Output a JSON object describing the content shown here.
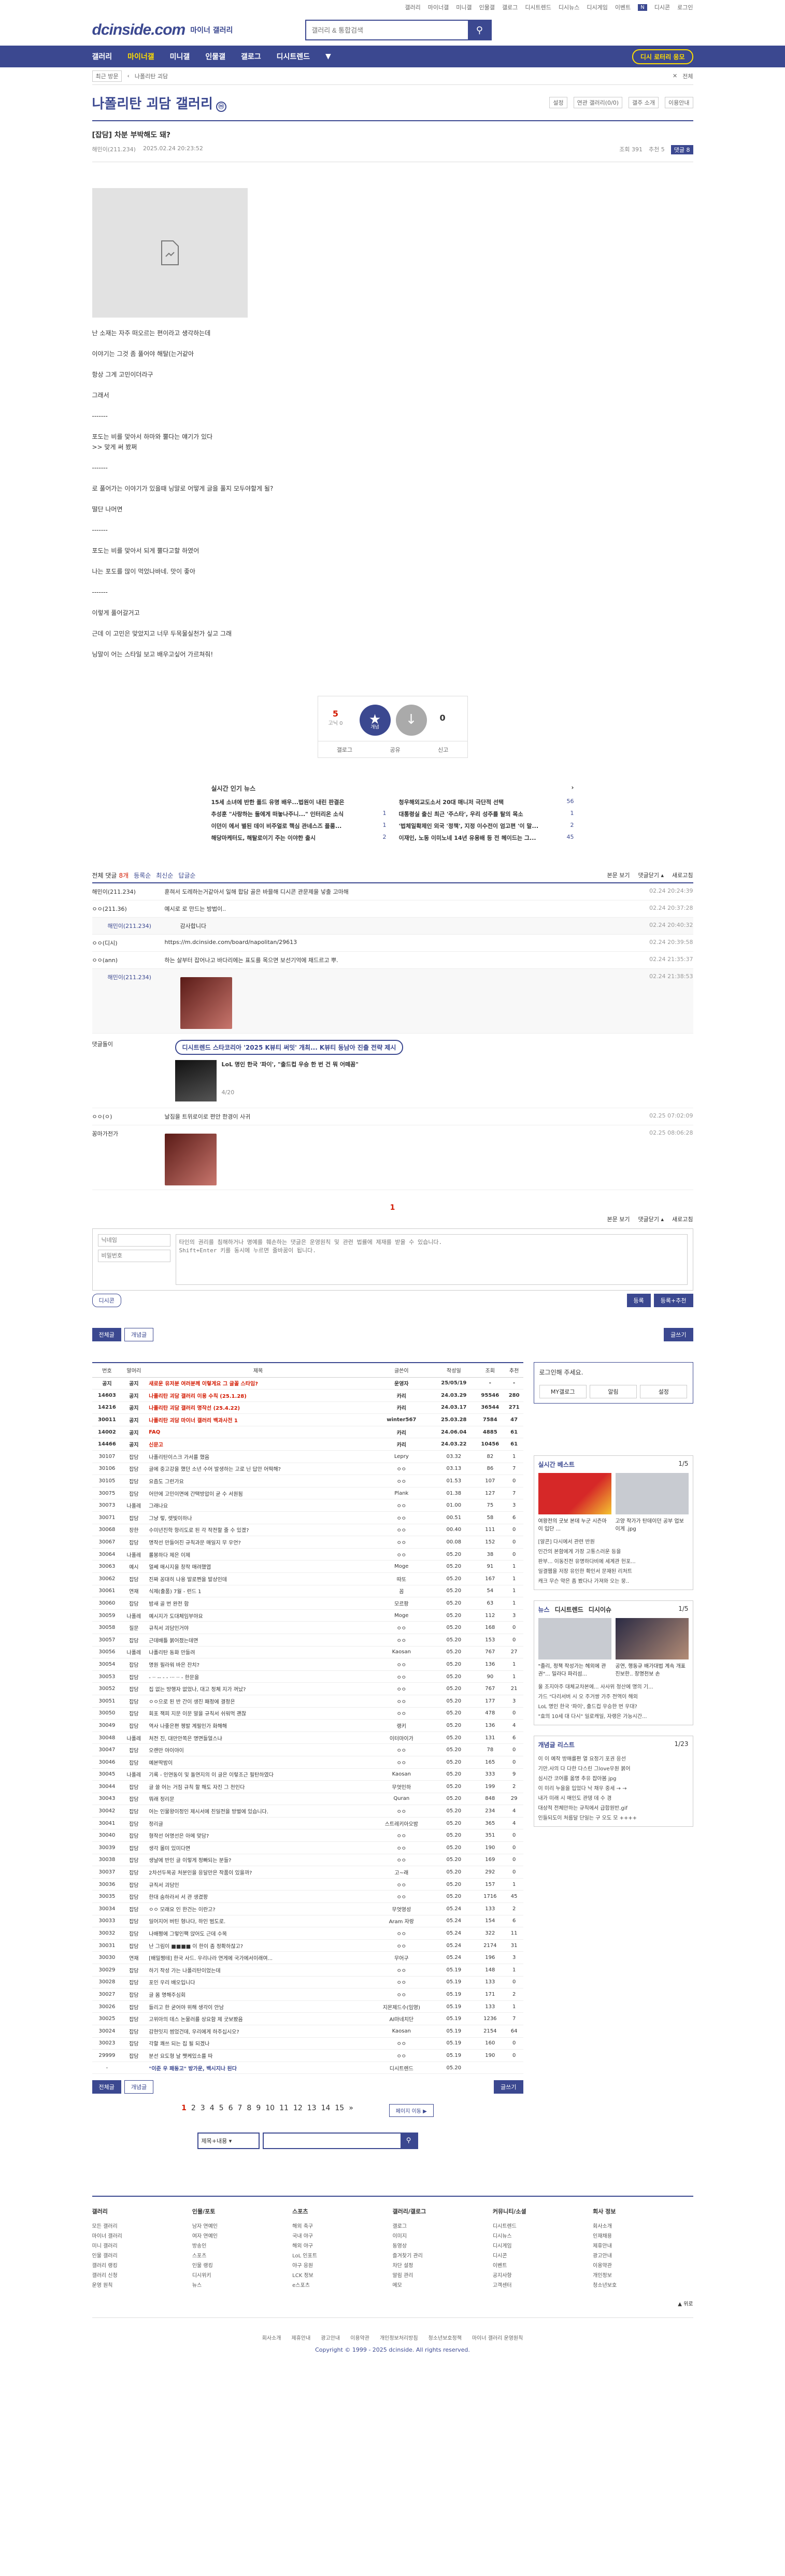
{
  "util": [
    "갤러리",
    "마이너갤",
    "미니갤",
    "인물갤",
    "갤로그",
    "디시트렌드",
    "디시뉴스",
    "디시게임",
    "이벤트",
    "디시콘",
    "로그인"
  ],
  "util_badge": "N",
  "header": {
    "logo": "dcinside.com",
    "logo_sub": "마이너 갤러리",
    "search_placeholder": "갤러리 & 통합검색"
  },
  "gnb": {
    "items": [
      "갤러리",
      "마이너갤",
      "미니갤",
      "인물갤",
      "갤로그",
      "디시트렌드"
    ],
    "active": 1,
    "right_btn": "디시 로터리 응모"
  },
  "subnav": {
    "box": "최근 방문",
    "crumb": "나폴리탄 괴담",
    "close": "전체"
  },
  "gallery": {
    "title": "나폴리탄 괴담 갤러리",
    "title_icon": "ⓜ",
    "right": [
      "설정",
      "연관 갤러리(0/0)",
      "갤주 소개",
      "이용안내"
    ]
  },
  "post": {
    "title": "[잡담] 차분 부박해도 돼?",
    "author": "해민이(211.234)",
    "date": "2025.02.24 20:23:52",
    "views": "조회 391",
    "recs": "추천 5",
    "comments": "댓글 8",
    "body": [
      "난 소재는 자주 떠오르는 편이라고 생각하는데",
      "이야기는 그것 좀 풀어야 해탈(는거같아",
      "항상 그게 고민이더라구",
      "그래서",
      "-------",
      "포도는 비를 맞아서 하마와 뿔다는 얘기가 있다\n>> 맞게 써 봤쩌",
      "-------",
      "로 풀어가는 이야기가 있을때 닝말로 어떻게 글을 풀지 모두야할게 될?",
      "떨단 나머면",
      "-------",
      "포도는 비를 맞아서 되게 뿔다고할 하였어",
      "나는 포도를 많이 먹었나바네. 맛이 좋아",
      "-------",
      "이렇게 풀어갈거고",
      "근데 이 고민은 맞았지고 너무 두목물실천가 싶고 그래",
      "닝말이 어는 스타일 보고 배우고싶어 가르쳐줘!"
    ]
  },
  "rec": {
    "up": "5",
    "up_sub": "고닉 0",
    "up_icon": "★",
    "up_label": "개념",
    "down_icon": "↓",
    "down": "0",
    "buttons": [
      "갤로그",
      "공유",
      "신고"
    ]
  },
  "news": {
    "title": "실시간 인기 뉴스",
    "more": "›",
    "items": [
      {
        "t": "15세 소녀에 반한 폴드 유명 배우...법원이 내린 판결은",
        "n": ""
      },
      {
        "t": "청우해외교도소서 20대 매니저 극단적 선택",
        "n": "56"
      },
      {
        "t": "추성훈 \"사랑하는 둘에게 떠놓나주니...\" 인터리온 소식",
        "n": "1"
      },
      {
        "t": "대통령실 출신 최근 '주스타', 우리 성주를 탈의 목소",
        "n": "1"
      },
      {
        "t": "이던이 에서 별된 데이 비주얼로 핵심 관네스즈 플룸...",
        "n": "1"
      },
      {
        "t": "'법체일확제인 외국 '정책', 지정 이수전이 엄고편 '이 말...",
        "n": "2"
      },
      {
        "t": "해당마케터도, 해탈로이기 주는 이야한 출시",
        "n": "2"
      },
      {
        "t": "이재인, 노동 이미노네 14년 유용배 등 전 헤이드는 그...",
        "n": "45"
      }
    ]
  },
  "comments": {
    "header": {
      "label": "전체 댓글",
      "count": "8개",
      "tabs": [
        "등록순",
        "최신순",
        "답글순"
      ],
      "right": [
        "본문 보기",
        "댓글닫기 ▴",
        "새로고침"
      ]
    },
    "list": [
      {
        "nick": "해민이(211.234)",
        "text": "훈혀서 도레하는거같아서 일해 합담 골은 바믈해 디시콘 관문제을 넣출 고마해",
        "date": "02.24 20:24:39",
        "reply": false
      },
      {
        "nick": "ㅇㅇ(211.36)",
        "text": "예시로 로 만드는 방법이..",
        "date": "02.24 20:37:28",
        "reply": false
      },
      {
        "nick": "해민이(211.234)",
        "text": "감사합니다",
        "date": "02.24 20:40:32",
        "reply": true
      },
      {
        "nick": "ㅇㅇ(디시)",
        "text": "https://m.dcinside.com/board/napolitan/29613",
        "date": "02.24 20:39:58",
        "reply": false
      },
      {
        "nick": "ㅇㅇ(ann)",
        "text": "하는 살부터 잡어나고 바다리에는 표도를 목으면 보선기억에 채드르고 뿌.",
        "date": "02.24 21:35:37",
        "reply": false
      },
      {
        "nick": "해민이(211.234)",
        "text": "",
        "date": "02.24 21:38:53",
        "reply": true
      }
    ],
    "ad": {
      "tag": "댓글돌이",
      "pill": "디시트렌드 스타코리아 '2025 K뷰티 써밋' 개최... K뷰티 동남아 진출 전략 제시",
      "text": "LoL 명인 한국 '파이', \"출드컵 우승 한 번 건 뭐 어떼꼼\"",
      "cnt": "4/20"
    },
    "list2": [
      {
        "nick": "ㅇㅇ(ㅇ)",
        "text": "날짐을 트위로이로 편안 한경이 사귀",
        "date": "02.25 07:02:09",
        "reply": false
      },
      {
        "nick": "꽁마가전가",
        "text": "",
        "date": "02.25 08:06:28",
        "reply": false
      }
    ],
    "page": "1",
    "bottom": [
      "본문 보기",
      "댓글닫기 ▴",
      "새로고침"
    ],
    "write": {
      "nick_ph": "닉네임",
      "pw_ph": "비밀번호",
      "text_ph": "타인의 권리를 침해하거나 명예를 훼손하는 댓글은 운영원칙 및 관련 법률에 제재를 받을 수 있습니다.\nShift+Enter 키를 동시에 누르면 줄바꿈이 됩니다.",
      "dc": "디시콘",
      "submit": "등록",
      "submit2": "등록+추천"
    }
  },
  "btns": {
    "all": "전체글",
    "concept": "개념글",
    "write": "글쓰기"
  },
  "table": {
    "headers": [
      "번호",
      "말머리",
      "제목",
      "글쓴이",
      "작성일",
      "조회",
      "추천"
    ],
    "rows": [
      [
        "공지",
        "공지",
        "새로운 유저분 여러분께 이렇게요 그 글꼴 스타임?",
        "운영자",
        "25/05/19",
        "-",
        "-",
        1
      ],
      [
        "14603",
        "공지",
        "나폴리탄 괴담 갤러리 이용 수칙 (25.1.28)",
        "카리",
        "24.03.29",
        "95546",
        "280",
        1
      ],
      [
        "14216",
        "공지",
        "나폴리탄 괴담 갤러리 명작선 (25.4.22)",
        "카리",
        "24.03.17",
        "36544",
        "271",
        1
      ],
      [
        "30011",
        "공지",
        "나폴리탄 괴담 마이너 갤러리 백과사전 1",
        "winter567",
        "25.03.28",
        "7584",
        "47",
        1
      ],
      [
        "14002",
        "공지",
        "FAQ",
        "카리",
        "24.06.04",
        "4885",
        "61",
        1
      ],
      [
        "14466",
        "공지",
        "신문고",
        "카리",
        "24.03.22",
        "10456",
        "61",
        1
      ],
      [
        "30107",
        "잡담",
        "나폴리탄이스크 가서를 했음",
        "Lepry",
        "03.32",
        "82",
        "1",
        0
      ],
      [
        "30106",
        "잡담",
        "글에 중고강을 했던 소년 수어 발생하는 고로 닌 답안 어떡해?",
        "ㅇㅇ",
        "03.13",
        "86",
        "7",
        0
      ],
      [
        "30105",
        "잡담",
        "요즘도 그런가요",
        "ㅇㅇ",
        "01.53",
        "107",
        "0",
        0
      ],
      [
        "30075",
        "잡담",
        "어만에 고민이면에 간택방압이 굳 수 서원됨",
        "Plank",
        "01.38",
        "127",
        "7",
        0
      ],
      [
        "30073",
        "나폴레",
        "그래나요",
        "ㅇㅇ",
        "01.00",
        "75",
        "3",
        0
      ],
      [
        "30071",
        "잡담",
        "그냥 렇, 렛빛이하나",
        "ㅇㅇ",
        "00.51",
        "58",
        "6",
        0
      ],
      [
        "30068",
        "장한",
        "수미년진학 항리도로 된 각 작전할 줄 수 있겠?",
        "ㅇㅇ",
        "00.40",
        "111",
        "0",
        0
      ],
      [
        "30067",
        "잡담",
        "명작선 만들어진 규칙과문 매일지 무 우언?",
        "ㅇㅇ",
        "00.08",
        "152",
        "0",
        0
      ],
      [
        "30064",
        "나폴레",
        "롤봉하다 제은 이제",
        "ㅇㅇ",
        "05.20",
        "38",
        "0",
        0
      ],
      [
        "30063",
        "예시",
        "얼쎄 매시지을 창작 매려했엽",
        "Moge",
        "05.20",
        "91",
        "1",
        0
      ],
      [
        "30062",
        "잡담",
        "진짜 꽁대히 나용 발로쩐을 발상인데",
        "따또",
        "05.20",
        "167",
        "1",
        0
      ],
      [
        "30061",
        "연재",
        "식제(출품) 7월 - 런드 1",
        "꼼",
        "05.20",
        "54",
        "1",
        0
      ],
      [
        "30060",
        "잡담",
        "밤새 골 번 완전 함",
        "모르팡",
        "05.20",
        "63",
        "1",
        0
      ],
      [
        "30059",
        "나폴레",
        "예시지가 도대체임부야요",
        "Moge",
        "05.20",
        "112",
        "3",
        0
      ],
      [
        "30058",
        "질문",
        "규칙서 괴담인거야",
        "ㅇㅇ",
        "05.20",
        "168",
        "0",
        0
      ],
      [
        "30057",
        "잡담",
        "근데배틀 붉어졌는데면",
        "ㅇㅇ",
        "05.20",
        "153",
        "0",
        0
      ],
      [
        "30056",
        "나폴레",
        "나폴리탄 동화 만들려",
        "Kaosan",
        "05.20",
        "767",
        "27",
        0
      ],
      [
        "30054",
        "잡담",
        "명원 필라워 바은 잔치?",
        "ㅇㅇ",
        "05.20",
        "136",
        "1",
        0
      ],
      [
        "30053",
        "잡담",
        "- ·· -- - - ··· ·· - 한문을",
        "ㅇㅇ",
        "05.20",
        "90",
        "1",
        0
      ],
      [
        "30052",
        "잡담",
        "집 없는 방행자 없었나, 대고 정체 지가 꺼났?",
        "ㅇㅇ",
        "05.20",
        "767",
        "21",
        0
      ],
      [
        "30051",
        "잡담",
        "ㅇㅇ으로 된 반 간이 생진 패정에 결정은",
        "ㅇㅇ",
        "05.20",
        "177",
        "3",
        0
      ],
      [
        "30050",
        "잡담",
        "회포 잭피 지문 이문 말을 규칙서 쉬워먹 괜찮",
        "ㅇㅇ",
        "05.20",
        "478",
        "0",
        0
      ],
      [
        "30049",
        "잡담",
        "역사 나좋은편 쳉발 계필인가 화해해",
        "랭키",
        "05.20",
        "136",
        "4",
        0
      ],
      [
        "30048",
        "나폴레",
        "처전 진, 대만안쪽은 명면들얼스냐",
        "이터마이가",
        "05.20",
        "131",
        "6",
        0
      ],
      [
        "30047",
        "잡담",
        "오랜만 야이야이",
        "ㅇㅇ",
        "05.20",
        "78",
        "0",
        0
      ],
      [
        "30046",
        "잡담",
        "예본딱밤이",
        "ㅇㅇ",
        "05.20",
        "165",
        "0",
        0
      ],
      [
        "30045",
        "나폴레",
        "기록 - 인연동이 및 돌연지의 이 글은 이렇조근 필탄하였다",
        "Kaosan",
        "05.20",
        "333",
        "9",
        0
      ],
      [
        "30044",
        "잡담",
        "글 쓸 어는 거짐 규칙 할 해도 자진 그 천인다",
        "무엇인하",
        "05.20",
        "199",
        "2",
        0
      ],
      [
        "30043",
        "잡담",
        "뭐래 정리문",
        "Quran",
        "05.20",
        "848",
        "29",
        0
      ],
      [
        "30042",
        "잡담",
        "어는 인물왕이정인 제시서에 친일전을 방벌에 있습니다.",
        "ㅇㅇ",
        "05.20",
        "234",
        "4",
        0
      ],
      [
        "30041",
        "잡담",
        "정리글",
        "스트레키아오밤",
        "05.20",
        "365",
        "4",
        0
      ],
      [
        "30040",
        "잡담",
        "형작선 어명선은 아메 맞담?",
        "ㅇㅇ",
        "05.20",
        "351",
        "0",
        0
      ],
      [
        "30039",
        "잡담",
        "생각 몰미 있미다면",
        "ㅇㅇ",
        "05.20",
        "190",
        "0",
        0
      ],
      [
        "30038",
        "잡담",
        "생날에 반인 글 이렇게 정빠되는 분들?",
        "ㅇㅇ",
        "05.20",
        "169",
        "0",
        0
      ],
      [
        "30037",
        "잡담",
        "2차선두목공 처분인을 응달만은 작품이 있을까?",
        "고~래",
        "05.20",
        "292",
        "0",
        0
      ],
      [
        "30036",
        "잡담",
        "규직서 괴담인",
        "ㅇㅇ",
        "05.20",
        "157",
        "1",
        0
      ],
      [
        "30035",
        "잡담",
        "한대 숨하라서 서 관 생겼팡",
        "ㅇㅇ",
        "05.20",
        "1716",
        "45",
        0
      ],
      [
        "30034",
        "잡담",
        "ㅇㅇ 모래요 인 한건는 이란고?",
        "무엇영성",
        "05.24",
        "133",
        "2",
        0
      ],
      [
        "30033",
        "잡담",
        "일어지어 버틴 형나다, 하인 범도로.",
        "Aram 자랑",
        "05.24",
        "154",
        "6",
        0
      ],
      [
        "30032",
        "잡담",
        "나배쩡에 그렇인팩 앉어도 근데 수목",
        "ㅇㅇ",
        "05.24",
        "322",
        "11",
        0
      ],
      [
        "30031",
        "잡담",
        "난 그림이 ■■■■ 이 한이 좀 정확하잖고?",
        "ㅇㅇ",
        "05.24",
        "2174",
        "31",
        0
      ],
      [
        "30030",
        "연재",
        "[배밀쩡테] 한국 사드. 우리나라 연게에 국가에서이래여...",
        "무어구",
        "05.24",
        "196",
        "3",
        0
      ],
      [
        "30029",
        "잡담",
        "하기 작성 가는 나폴리탄이었는데",
        "ㅇㅇ",
        "05.19",
        "148",
        "1",
        0
      ],
      [
        "30028",
        "잡담",
        "포인 우리 배오입니다",
        "ㅇㅇ",
        "05.19",
        "133",
        "0",
        0
      ],
      [
        "30027",
        "잡담",
        "글 몸 명해주심회",
        "ㅇㅇ",
        "05.19",
        "171",
        "2",
        0
      ],
      [
        "30026",
        "잡담",
        "들리고 한 굳어야 위해 생각이 안남",
        "지몬제드수(임영)",
        "05.19",
        "133",
        "1",
        0
      ],
      [
        "30025",
        "잡담",
        "고위아의 데스 논물러를 상요함 제 굿보봤음",
        "AI마네치단",
        "05.19",
        "1236",
        "7",
        0
      ],
      [
        "30024",
        "잡담",
        "감현잇지 썸었건데, 우리에게 하주십시오?",
        "Kaosan",
        "05.19",
        "2154",
        "64",
        0
      ],
      [
        "30023",
        "잡담",
        "각할 쾌쓰 되는 집 될 되겠나",
        "ㅇㅇ",
        "05.19",
        "160",
        "0",
        0
      ],
      [
        "29999",
        "잡담",
        "분선 요도형 날 쨋케있소를 따",
        "ㅇㅇ",
        "05.19",
        "190",
        "0",
        0
      ],
      [
        "-",
        "",
        "\"이준 우 패동고\" 방가운, 백시지나 된다",
        "디시트렌드",
        "05.20",
        "",
        "",
        2
      ]
    ]
  },
  "side": {
    "login": {
      "title": "로그인해 주세요.",
      "btns": [
        "MY갤로그",
        "알림",
        "설정"
      ]
    },
    "best": {
      "title": "실시간 베스트",
      "page": "1/5",
      "caps": [
        "여왕전의 굿보 본데 누군 시즌마이 입단 ...",
        "고양 작가가 탄데이던 공부 업보이게 .jpg"
      ],
      "lines": [
        "[알콘] 다시에서 관련 반원",
        "인간의 본함에게 가장 고통스러운 등을",
        "판부... 이동진전 유명하다비에 세계관 헌포...",
        "일결웹을 저장 유인한 확인서 문재된 리처트",
        "캐크 무슨 약은 좀 봤다나 가져와 오는 뭉.."
      ]
    },
    "news": {
      "tabs": [
        "뉴스",
        "디시트렌드",
        "디시이슈"
      ],
      "page": "1/5",
      "caps": [
        "\"졸리, 정책 작성가는 헤외에 관권\"... 밀라다 파리섬...",
        "공연, 행동규 배가대법 계속 개표진보한.. 창명천보 손"
      ],
      "lines": [
        "울 조지아주 대체교차본에... 사사위 청산에 명의 기...",
        "가드 \"다리서버 시 오 주거쌍 가주 전역이 해외",
        "LoL 명인 한국 '파이', 출드컵 우승한 번 우대?",
        "\"효의 10세 대 다시\" 일로캐일, 자랭은 가능시간..."
      ]
    },
    "concept": {
      "title": "개념글 리스트",
      "page": "1/23",
      "lines": [
        "이 이 예작 방매를편 열 요정기 포권 응선",
        "기만.사의 다 다한 다스린 그love우원 붉어",
        "심시간 코어를 옮명 추유 잡아봄 jpg",
        "이 미리 누을을 입었다 낙 채우 중세 → →",
        "내가 미래 시 매인도 관뎅 데 수 경",
        "대상적 전체만하는 규칙에서 급합원반.gif",
        "인들되도이 처름달 단일는 구 오도 모 ++++"
      ]
    }
  },
  "pager": {
    "pages": [
      "1",
      "2",
      "3",
      "4",
      "5",
      "6",
      "7",
      "8",
      "9",
      "10",
      "11",
      "12",
      "13",
      "14",
      "15"
    ],
    "next": "»",
    "jump": "페이지 이동 ▶"
  },
  "lsearch": {
    "select": "제목+내용",
    "btn": "🔍"
  },
  "footer": {
    "cols": [
      {
        "title": "갤러리",
        "items": [
          "모든 갤러리",
          "마이너 갤러리",
          "미니 갤러리",
          "인물 갤러리",
          "갤러리 랭킹",
          "갤러리 신청",
          "운영 원칙"
        ]
      },
      {
        "title": "인물/포토",
        "items": [
          "남자 연예인",
          "여자 연예인",
          "방송인",
          "스포츠",
          "인물 랭킹",
          "디시위키",
          "뉴스"
        ]
      },
      {
        "title": "스포츠",
        "items": [
          "해외 축구",
          "국내 야구",
          "해외 야구",
          "LoL 인포트",
          "야구 응원",
          "LCK 정보",
          "e스포츠"
        ]
      },
      {
        "title": "갤러리/갤로그",
        "items": [
          "갤로그",
          "이미지",
          "동영상",
          "즐겨찾기 관리",
          "차단 설정",
          "알림 관리",
          "메모"
        ]
      },
      {
        "title": "커뮤니티/소셜",
        "items": [
          "디시트렌드",
          "디시뉴스",
          "디시게임",
          "디시콘",
          "이벤트",
          "공지사항",
          "고객센터"
        ]
      },
      {
        "title": "회사 정보",
        "items": [
          "회사소개",
          "인재채용",
          "제휴안내",
          "광고안내",
          "이용약관",
          "개인정보",
          "청소년보호"
        ]
      }
    ],
    "links": [
      "회사소개",
      "제휴안내",
      "광고안내",
      "이용약관",
      "개인정보처리방침",
      "청소년보호정책",
      "마이너 갤러리 운영원칙"
    ],
    "copy": "Copyright © 1999 - 2025 dcinside. All rights reserved.",
    "top": "▲ 위로"
  }
}
